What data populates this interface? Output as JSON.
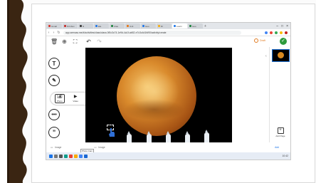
{
  "browser": {
    "tabs": [
      {
        "label": "Gmail",
        "color": "#d93025"
      },
      {
        "label": "M Inbox",
        "color": "#c5221f"
      },
      {
        "label": "N",
        "color": "#333333"
      },
      {
        "label": "Ele",
        "color": "#1a73e8"
      },
      {
        "label": "Clas",
        "color": "#188038"
      },
      {
        "label": "Unit",
        "color": "#e8710a"
      },
      {
        "label": "Goo",
        "color": "#1a73e8"
      },
      {
        "label": "Dr",
        "color": "#f9ab00"
      },
      {
        "label": "Learn",
        "color": "#1a73e8"
      },
      {
        "label": "Goo",
        "color": "#188038"
      }
    ],
    "active_tab_index": 8,
    "url": "app.seesaw.me/#/activities/class/class.0f0c3c74-1e9d-4a1f-ab52-e7c3c4d1fd90/activity/create"
  },
  "app_toolbar": {
    "icons": [
      "trash-icon",
      "zoom-in-icon",
      "crop-icon",
      "undo-icon",
      "redo-icon"
    ],
    "draft_label": "Draft",
    "done_icon": "checkmark-icon"
  },
  "left_tools": {
    "text_tool": "T",
    "media_items": [
      {
        "label": "Photo",
        "icon": "camera-icon"
      },
      {
        "label": "Video",
        "icon": "video-icon"
      },
      {
        "label": "Upload",
        "icon": "upload-icon"
      }
    ]
  },
  "right_panel": {
    "add_page_label": "Add Page"
  },
  "status": {
    "left_text": "Image",
    "mid_text": "Image",
    "tooltip": "Photo  Cam",
    "right_text": "Add"
  },
  "taskbar": {
    "icons": [
      "start-icon",
      "search-icon",
      "taskview-icon",
      "edge-icon",
      "chrome-icon",
      "explorer-icon",
      "store-icon",
      "mail-icon"
    ],
    "time": "10:42"
  },
  "colors": {
    "done_green": "#2e9b3c",
    "draft_orange": "#e07a1f",
    "selection_blue": "#1d6fd1"
  }
}
